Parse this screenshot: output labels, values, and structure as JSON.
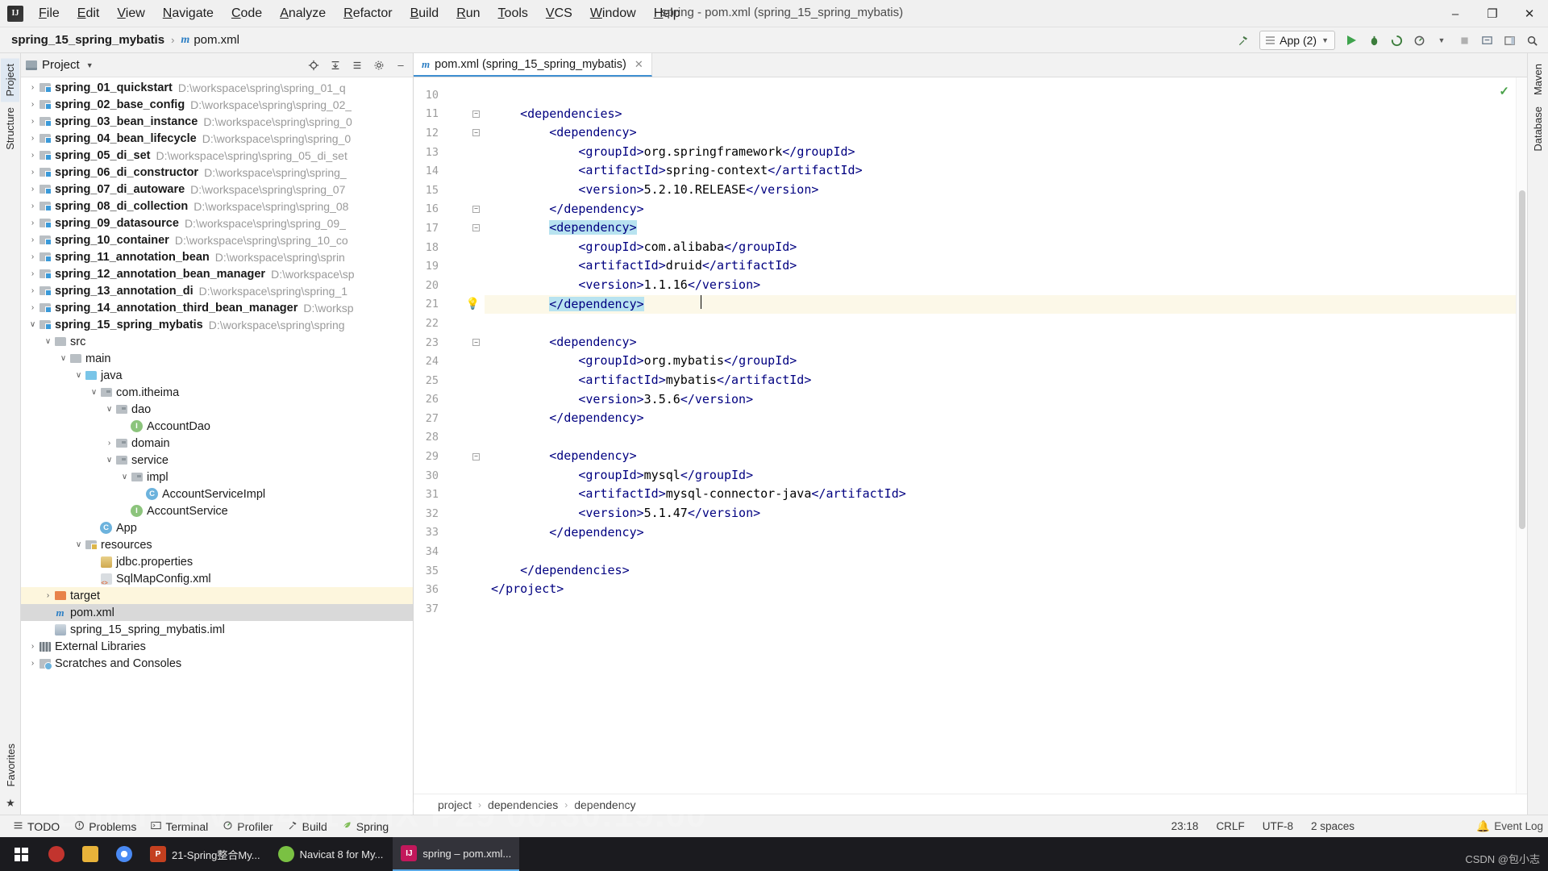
{
  "window": {
    "title": "spring - pom.xml (spring_15_spring_mybatis)",
    "minimize": "–",
    "maximize": "❐",
    "close": "✕"
  },
  "menu": [
    "File",
    "Edit",
    "View",
    "Navigate",
    "Code",
    "Analyze",
    "Refactor",
    "Build",
    "Run",
    "Tools",
    "VCS",
    "Window",
    "Help"
  ],
  "breadcrumb_top": {
    "project": "spring_15_spring_mybatis",
    "file": "pom.xml",
    "separator": "›"
  },
  "toolbar": {
    "build_hammer": "build-hammer",
    "run_config": "App (2)",
    "run": "run",
    "debug": "debug",
    "coverage": "run-with-coverage",
    "profile": "profiler",
    "stop": "stop",
    "search": "search",
    "layout": "layout"
  },
  "left_strip": {
    "tabs": [
      "Project",
      "Structure"
    ],
    "bottom": [
      "Favorites",
      "star"
    ]
  },
  "right_strip": {
    "tabs": [
      "Maven",
      "Database"
    ]
  },
  "project_panel": {
    "title": "Project",
    "actions": [
      "locate-icon",
      "collapse-all-icon",
      "expand-icon",
      "settings-icon",
      "hide-icon"
    ],
    "tree": [
      {
        "indent": 0,
        "arrow": "›",
        "icon": "module",
        "name": "spring_01_quickstart",
        "bold": true,
        "path": "D:\\workspace\\spring\\spring_01_q"
      },
      {
        "indent": 0,
        "arrow": "›",
        "icon": "module",
        "name": "spring_02_base_config",
        "bold": true,
        "path": "D:\\workspace\\spring\\spring_02_"
      },
      {
        "indent": 0,
        "arrow": "›",
        "icon": "module",
        "name": "spring_03_bean_instance",
        "bold": true,
        "path": "D:\\workspace\\spring\\spring_0"
      },
      {
        "indent": 0,
        "arrow": "›",
        "icon": "module",
        "name": "spring_04_bean_lifecycle",
        "bold": true,
        "path": "D:\\workspace\\spring\\spring_0"
      },
      {
        "indent": 0,
        "arrow": "›",
        "icon": "module",
        "name": "spring_05_di_set",
        "bold": true,
        "path": "D:\\workspace\\spring\\spring_05_di_set"
      },
      {
        "indent": 0,
        "arrow": "›",
        "icon": "module",
        "name": "spring_06_di_constructor",
        "bold": true,
        "path": "D:\\workspace\\spring\\spring_"
      },
      {
        "indent": 0,
        "arrow": "›",
        "icon": "module",
        "name": "spring_07_di_autoware",
        "bold": true,
        "path": "D:\\workspace\\spring\\spring_07"
      },
      {
        "indent": 0,
        "arrow": "›",
        "icon": "module",
        "name": "spring_08_di_collection",
        "bold": true,
        "path": "D:\\workspace\\spring\\spring_08"
      },
      {
        "indent": 0,
        "arrow": "›",
        "icon": "module",
        "name": "spring_09_datasource",
        "bold": true,
        "path": "D:\\workspace\\spring\\spring_09_"
      },
      {
        "indent": 0,
        "arrow": "›",
        "icon": "module",
        "name": "spring_10_container",
        "bold": true,
        "path": "D:\\workspace\\spring\\spring_10_co"
      },
      {
        "indent": 0,
        "arrow": "›",
        "icon": "module",
        "name": "spring_11_annotation_bean",
        "bold": true,
        "path": "D:\\workspace\\spring\\sprin"
      },
      {
        "indent": 0,
        "arrow": "›",
        "icon": "module",
        "name": "spring_12_annotation_bean_manager",
        "bold": true,
        "path": "D:\\workspace\\sp"
      },
      {
        "indent": 0,
        "arrow": "›",
        "icon": "module",
        "name": "spring_13_annotation_di",
        "bold": true,
        "path": "D:\\workspace\\spring\\spring_1"
      },
      {
        "indent": 0,
        "arrow": "›",
        "icon": "module",
        "name": "spring_14_annotation_third_bean_manager",
        "bold": true,
        "path": "D:\\worksp"
      },
      {
        "indent": 0,
        "arrow": "∨",
        "icon": "module",
        "name": "spring_15_spring_mybatis",
        "bold": true,
        "path": "D:\\workspace\\spring\\spring"
      },
      {
        "indent": 1,
        "arrow": "∨",
        "icon": "folder",
        "name": "src",
        "bold": false,
        "path": ""
      },
      {
        "indent": 2,
        "arrow": "∨",
        "icon": "folder",
        "name": "main",
        "bold": false,
        "path": ""
      },
      {
        "indent": 3,
        "arrow": "∨",
        "icon": "folder-blue",
        "name": "java",
        "bold": false,
        "path": ""
      },
      {
        "indent": 4,
        "arrow": "∨",
        "icon": "package",
        "name": "com.itheima",
        "bold": false,
        "path": ""
      },
      {
        "indent": 5,
        "arrow": "∨",
        "icon": "package",
        "name": "dao",
        "bold": false,
        "path": ""
      },
      {
        "indent": 6,
        "arrow": "",
        "icon": "interface",
        "name": "AccountDao",
        "bold": false,
        "path": ""
      },
      {
        "indent": 5,
        "arrow": "›",
        "icon": "package",
        "name": "domain",
        "bold": false,
        "path": ""
      },
      {
        "indent": 5,
        "arrow": "∨",
        "icon": "package",
        "name": "service",
        "bold": false,
        "path": ""
      },
      {
        "indent": 6,
        "arrow": "∨",
        "icon": "package",
        "name": "impl",
        "bold": false,
        "path": ""
      },
      {
        "indent": 7,
        "arrow": "",
        "icon": "class",
        "name": "AccountServiceImpl",
        "bold": false,
        "path": ""
      },
      {
        "indent": 6,
        "arrow": "",
        "icon": "interface",
        "name": "AccountService",
        "bold": false,
        "path": ""
      },
      {
        "indent": 4,
        "arrow": "",
        "icon": "class-run",
        "name": "App",
        "bold": false,
        "path": ""
      },
      {
        "indent": 3,
        "arrow": "∨",
        "icon": "resources",
        "name": "resources",
        "bold": false,
        "path": ""
      },
      {
        "indent": 4,
        "arrow": "",
        "icon": "properties",
        "name": "jdbc.properties",
        "bold": false,
        "path": ""
      },
      {
        "indent": 4,
        "arrow": "",
        "icon": "xml",
        "name": "SqlMapConfig.xml",
        "bold": false,
        "path": ""
      },
      {
        "indent": 1,
        "arrow": "›",
        "icon": "folder-orange",
        "name": "target",
        "bold": false,
        "path": "",
        "highlight": true
      },
      {
        "indent": 1,
        "arrow": "",
        "icon": "maven",
        "name": "pom.xml",
        "bold": false,
        "path": "",
        "selected": true
      },
      {
        "indent": 1,
        "arrow": "",
        "icon": "iml",
        "name": "spring_15_spring_mybatis.iml",
        "bold": false,
        "path": ""
      },
      {
        "indent": 0,
        "arrow": "›",
        "icon": "library",
        "name": "External Libraries",
        "bold": false,
        "path": ""
      },
      {
        "indent": 0,
        "arrow": "›",
        "icon": "scratch",
        "name": "Scratches and Consoles",
        "bold": false,
        "path": ""
      }
    ]
  },
  "editor": {
    "tab_label": "pom.xml (spring_15_spring_mybatis)",
    "tab_icon": "maven-icon",
    "tab_close": "✕",
    "inspection_status": "✓",
    "bulb_line": 21,
    "lines": [
      {
        "n": 10,
        "text": "",
        "fold": false
      },
      {
        "n": 11,
        "text": "    <dependencies>",
        "fold": true
      },
      {
        "n": 12,
        "text": "        <dependency>",
        "fold": true
      },
      {
        "n": 13,
        "text": "            <groupId>org.springframework</groupId>",
        "fold": false
      },
      {
        "n": 14,
        "text": "            <artifactId>spring-context</artifactId>",
        "fold": false
      },
      {
        "n": 15,
        "text": "            <version>5.2.10.RELEASE</version>",
        "fold": false
      },
      {
        "n": 16,
        "text": "        </dependency>",
        "fold": true
      },
      {
        "n": 17,
        "text": "        <dependency>",
        "fold": true,
        "selected": true
      },
      {
        "n": 18,
        "text": "            <groupId>com.alibaba</groupId>",
        "fold": false
      },
      {
        "n": 19,
        "text": "            <artifactId>druid</artifactId>",
        "fold": false
      },
      {
        "n": 20,
        "text": "            <version>1.1.16</version>",
        "fold": false
      },
      {
        "n": 21,
        "text": "        </dependency>",
        "fold": false,
        "selected": true,
        "current": true
      },
      {
        "n": 22,
        "text": "",
        "fold": false
      },
      {
        "n": 23,
        "text": "        <dependency>",
        "fold": true
      },
      {
        "n": 24,
        "text": "            <groupId>org.mybatis</groupId>",
        "fold": false
      },
      {
        "n": 25,
        "text": "            <artifactId>mybatis</artifactId>",
        "fold": false
      },
      {
        "n": 26,
        "text": "            <version>3.5.6</version>",
        "fold": false
      },
      {
        "n": 27,
        "text": "        </dependency>",
        "fold": false
      },
      {
        "n": 28,
        "text": "",
        "fold": false
      },
      {
        "n": 29,
        "text": "        <dependency>",
        "fold": true
      },
      {
        "n": 30,
        "text": "            <groupId>mysql</groupId>",
        "fold": false
      },
      {
        "n": 31,
        "text": "            <artifactId>mysql-connector-java</artifactId>",
        "fold": false
      },
      {
        "n": 32,
        "text": "            <version>5.1.47</version>",
        "fold": false
      },
      {
        "n": 33,
        "text": "        </dependency>",
        "fold": false
      },
      {
        "n": 34,
        "text": "",
        "fold": false
      },
      {
        "n": 35,
        "text": "    </dependencies>",
        "fold": false
      },
      {
        "n": 36,
        "text": "</project>",
        "fold": false
      },
      {
        "n": 37,
        "text": "",
        "fold": false
      }
    ],
    "breadcrumb": [
      "project",
      "dependencies",
      "dependency"
    ],
    "breadcrumb_sep": "›"
  },
  "bottom_bar": {
    "items": [
      {
        "label": "TODO",
        "icon": "todo-icon"
      },
      {
        "label": "Problems",
        "icon": "problems-icon"
      },
      {
        "label": "Terminal",
        "icon": "terminal-icon"
      },
      {
        "label": "Profiler",
        "icon": "profiler-icon"
      },
      {
        "label": "Build",
        "icon": "build-hammer-icon"
      },
      {
        "label": "Spring",
        "icon": "spring-leaf-icon"
      }
    ],
    "status": {
      "position": "23:18",
      "line_sep": "CRLF",
      "encoding": "UTF-8",
      "indent": "2 spaces",
      "event_log": "Event Log"
    }
  },
  "taskbar": {
    "watermark": "Bilibili BV1H4y1S7iX P29 00:30:19.00",
    "csdn": "CSDN @包小志",
    "apps": [
      {
        "label": "",
        "icon": "windows-start",
        "color": "#1b1b1f"
      },
      {
        "label": "",
        "icon": "app-icon-red",
        "color": "#c2342e"
      },
      {
        "label": "",
        "icon": "file-explorer",
        "color": "#e8b33a"
      },
      {
        "label": "",
        "icon": "chrome",
        "color": "#4a8af4"
      },
      {
        "label": "21-Spring整合My...",
        "icon": "powerpoint",
        "color": "#c4401f"
      },
      {
        "label": "Navicat 8 for My...",
        "icon": "navicat",
        "color": "#7ac143"
      },
      {
        "label": "spring – pom.xml...",
        "icon": "intellij",
        "color": "#c2185b",
        "active": true
      }
    ]
  }
}
